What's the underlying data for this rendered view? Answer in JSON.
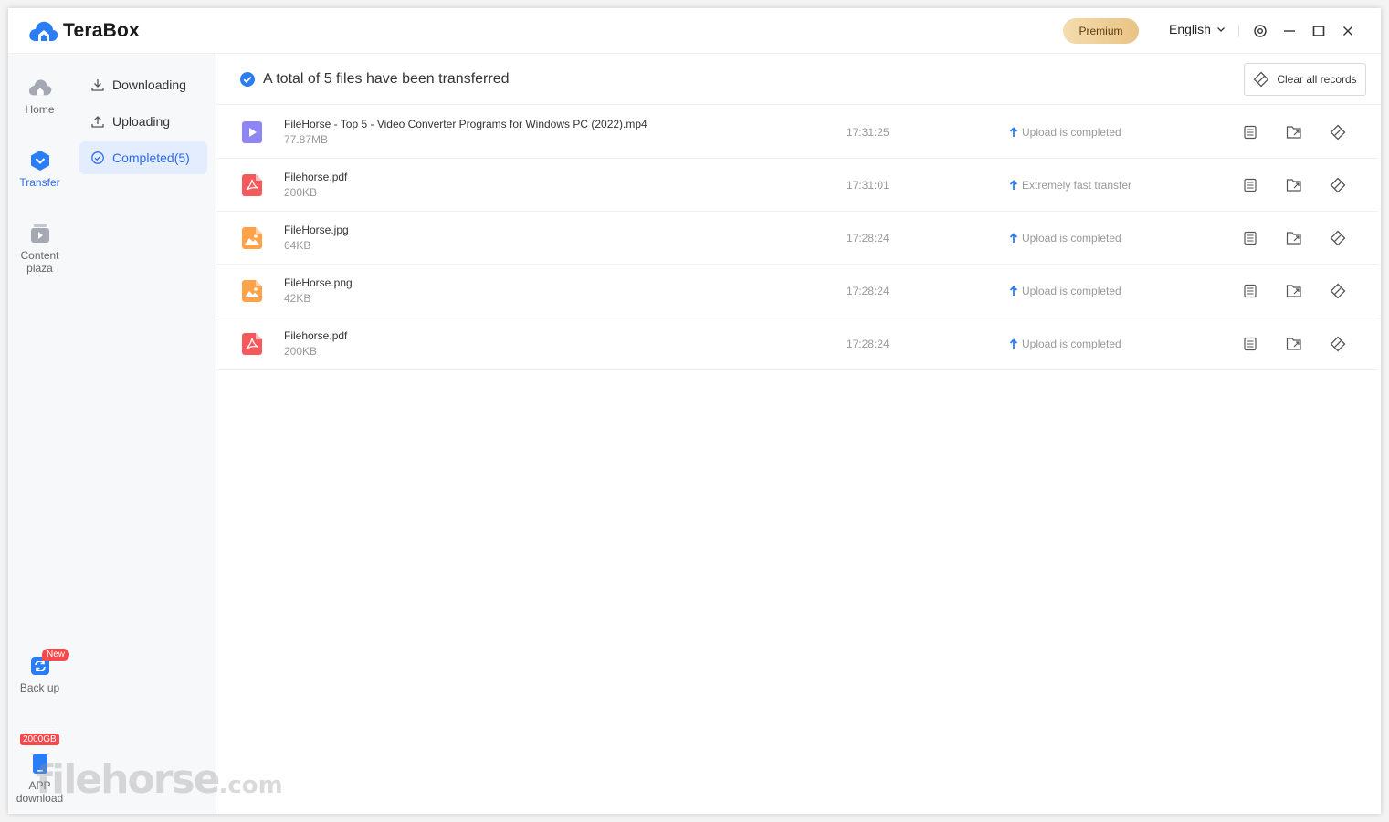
{
  "app": {
    "name": "TeraBox"
  },
  "titlebar": {
    "premium_label": "Premium",
    "language": "English"
  },
  "rail": {
    "home": "Home",
    "transfer": "Transfer",
    "content_line1": "Content",
    "content_line2": "plaza",
    "backup": "Back up",
    "backup_badge": "New",
    "storage_badge": "2000GB",
    "app_line1": "APP",
    "app_line2": "download"
  },
  "subnav": {
    "downloading": "Downloading",
    "uploading": "Uploading",
    "completed": "Completed(5)"
  },
  "summary": {
    "text": "A total of 5 files have been transferred",
    "clear_label": "Clear all records"
  },
  "files": [
    {
      "name": "FileHorse - Top 5 - Video Converter Programs for Windows PC (2022).mp4",
      "size": "77.87MB",
      "time": "17:31:25",
      "status": "Upload is completed",
      "type": "video"
    },
    {
      "name": "Filehorse.pdf",
      "size": "200KB",
      "time": "17:31:01",
      "status": "Extremely fast transfer",
      "type": "pdf"
    },
    {
      "name": "FileHorse.jpg",
      "size": "64KB",
      "time": "17:28:24",
      "status": "Upload is completed",
      "type": "image"
    },
    {
      "name": "FileHorse.png",
      "size": "42KB",
      "time": "17:28:24",
      "status": "Upload is completed",
      "type": "image"
    },
    {
      "name": "Filehorse.pdf",
      "size": "200KB",
      "time": "17:28:24",
      "status": "Upload is completed",
      "type": "pdf"
    }
  ],
  "watermark": {
    "main": "filehorse",
    "suffix": ".com"
  },
  "colors": {
    "accent": "#2a6bf2",
    "video": "#8e86f7",
    "pdf": "#f5595b",
    "image": "#ffa24a"
  }
}
